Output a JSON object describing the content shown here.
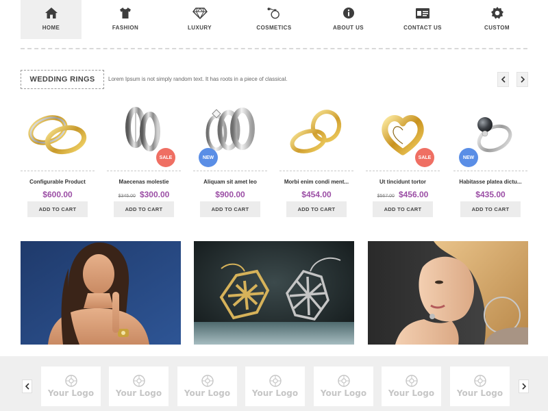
{
  "nav": {
    "items": [
      {
        "label": "HOME",
        "icon": "home-icon"
      },
      {
        "label": "FASHION",
        "icon": "tshirt-icon"
      },
      {
        "label": "LUXURY",
        "icon": "diamond-icon"
      },
      {
        "label": "COSMETICS",
        "icon": "perfume-icon"
      },
      {
        "label": "ABOUT US",
        "icon": "info-icon"
      },
      {
        "label": "CONTACT US",
        "icon": "contact-card-icon"
      },
      {
        "label": "CUSTOM",
        "icon": "gear-icon"
      }
    ],
    "active_index": 0
  },
  "section": {
    "title": "WEDDING RINGS",
    "description": "Lorem Ipsum is not simply random text. It has roots in a piece of classical."
  },
  "products": [
    {
      "name": "Configurable Product",
      "old_price": "",
      "price": "$600.00",
      "badge": "",
      "cta": "ADD TO CART"
    },
    {
      "name": "Maecenas molestie",
      "old_price": "$345.00",
      "price": "$300.00",
      "badge": "SALE",
      "cta": "ADD TO CART"
    },
    {
      "name": "Aliquam sit amet leo",
      "old_price": "",
      "price": "$900.00",
      "badge": "NEW",
      "cta": "ADD TO CART"
    },
    {
      "name": "Morbi enim condi ment...",
      "old_price": "",
      "price": "$454.00",
      "badge": "",
      "cta": "ADD TO CART"
    },
    {
      "name": "Ut tincidunt tortor",
      "old_price": "$567.00",
      "price": "$456.00",
      "badge": "SALE",
      "cta": "ADD TO CART"
    },
    {
      "name": "Habitasse platea dictu...",
      "old_price": "",
      "price": "$435.00",
      "badge": "NEW",
      "cta": "ADD TO CART"
    }
  ],
  "banners": [
    {
      "name": "woman-jewelry-banner"
    },
    {
      "name": "pendants-banner"
    },
    {
      "name": "blonde-woman-banner"
    }
  ],
  "logos": [
    "Your Logo",
    "Your Logo",
    "Your Logo",
    "Your Logo",
    "Your Logo",
    "Your Logo",
    "Your Logo"
  ],
  "colors": {
    "price": "#9b4ea5",
    "sale_badge": "#ef6f63",
    "new_badge": "#5a8ee6"
  }
}
